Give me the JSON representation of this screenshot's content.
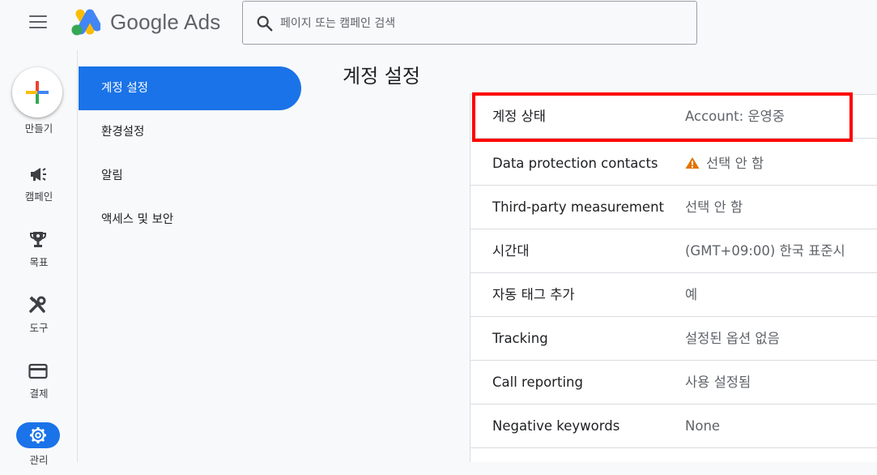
{
  "header": {
    "brand": "Google Ads",
    "search_placeholder": "페이지 또는 캠페인 검색"
  },
  "rail": {
    "create": "만들기",
    "campaigns": "캠페인",
    "goals": "목표",
    "tools": "도구",
    "billing": "결제",
    "admin": "관리"
  },
  "subnav": {
    "items": [
      "계정 설정",
      "환경설정",
      "알림",
      "액세스 및 보안"
    ]
  },
  "page": {
    "title": "계정 설정"
  },
  "settings": [
    {
      "label": "계정 상태",
      "value": "Account: 운영중"
    },
    {
      "label": "Data protection contacts",
      "value": "선택 안 함"
    },
    {
      "label": "Third-party measurement",
      "value": "선택 안 함"
    },
    {
      "label": "시간대",
      "value": "(GMT+09:00) 한국 표준시"
    },
    {
      "label": "자동 태그 추가",
      "value": "예"
    },
    {
      "label": "Tracking",
      "value": "설정된 옵션 없음"
    },
    {
      "label": "Call reporting",
      "value": "사용 설정됨"
    },
    {
      "label": "Negative keywords",
      "value": "None"
    }
  ],
  "colors": {
    "accent": "#1a73e8",
    "highlight": "#ff0000",
    "warning": "#e37400"
  }
}
